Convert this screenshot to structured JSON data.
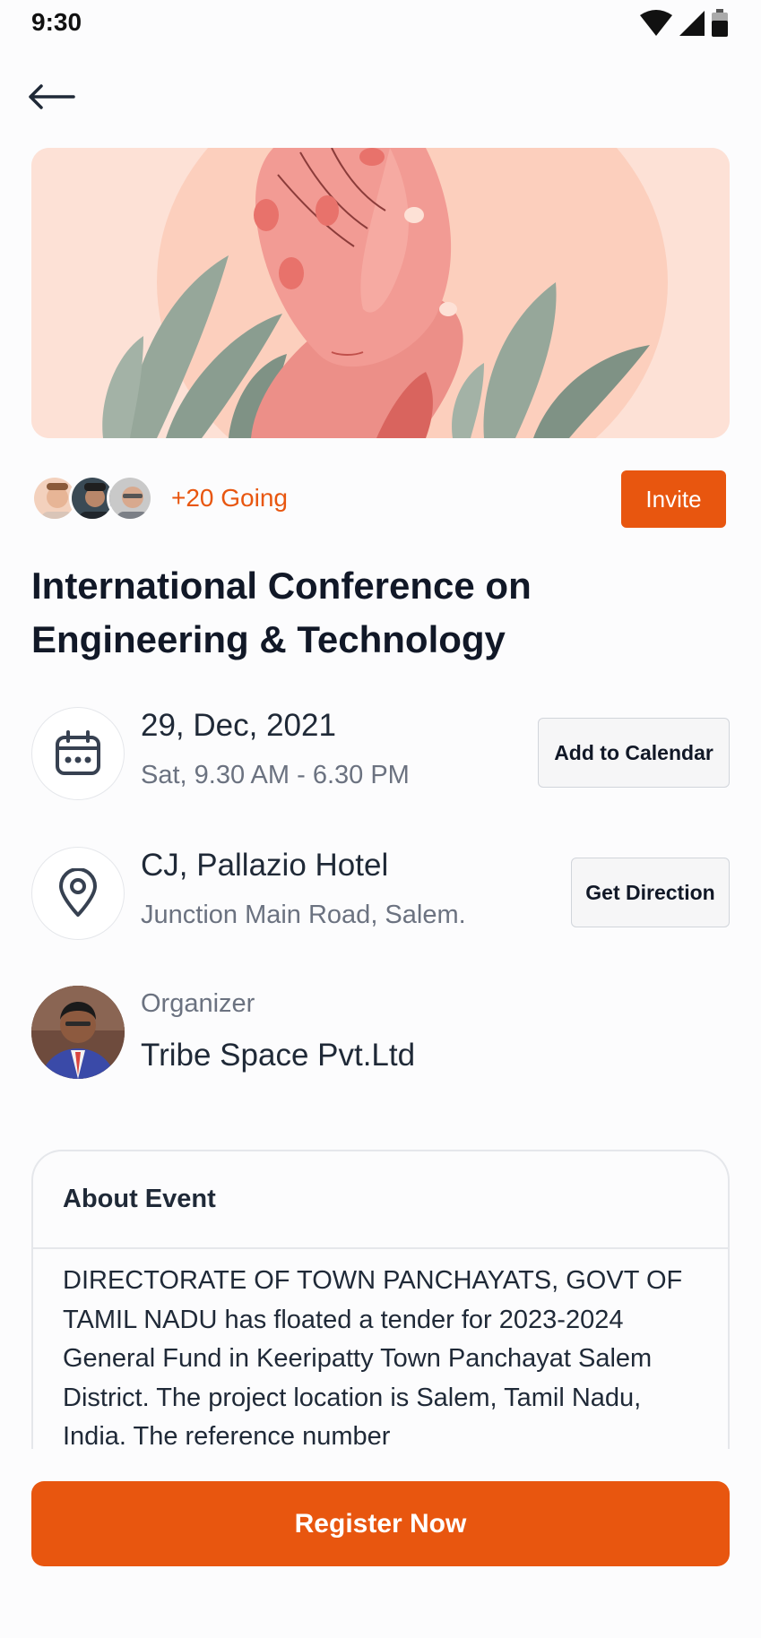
{
  "status_bar": {
    "time": "9:30"
  },
  "header": {
    "back_icon": "arrow-left-icon"
  },
  "hero": {
    "image": "hands-with-leaves-illustration"
  },
  "attendees": {
    "going_text": "+20 Going",
    "invite_label": "Invite"
  },
  "event": {
    "title": "International Conference on Engineering & Technology"
  },
  "date_info": {
    "icon": "calendar-icon",
    "date": "29, Dec, 2021",
    "time": "Sat, 9.30 AM - 6.30 PM",
    "button_label": "Add to Calendar"
  },
  "location_info": {
    "icon": "location-pin-icon",
    "venue": "CJ, Pallazio Hotel",
    "address": "Junction Main Road, Salem.",
    "button_label": "Get Direction"
  },
  "organizer": {
    "label": "Organizer",
    "name": "Tribe Space Pvt.Ltd"
  },
  "about": {
    "title": "About Event",
    "text": "DIRECTORATE OF TOWN PANCHAYATS, GOVT OF TAMIL NADU has floated a tender for 2023-2024 General Fund in Keeripatty Town Panchayat Salem District. The project location is Salem, Tamil Nadu, India. The reference number"
  },
  "footer": {
    "register_label": "Register Now"
  },
  "colors": {
    "accent": "#e8560f",
    "text": "#111827",
    "muted": "#6b7280"
  }
}
